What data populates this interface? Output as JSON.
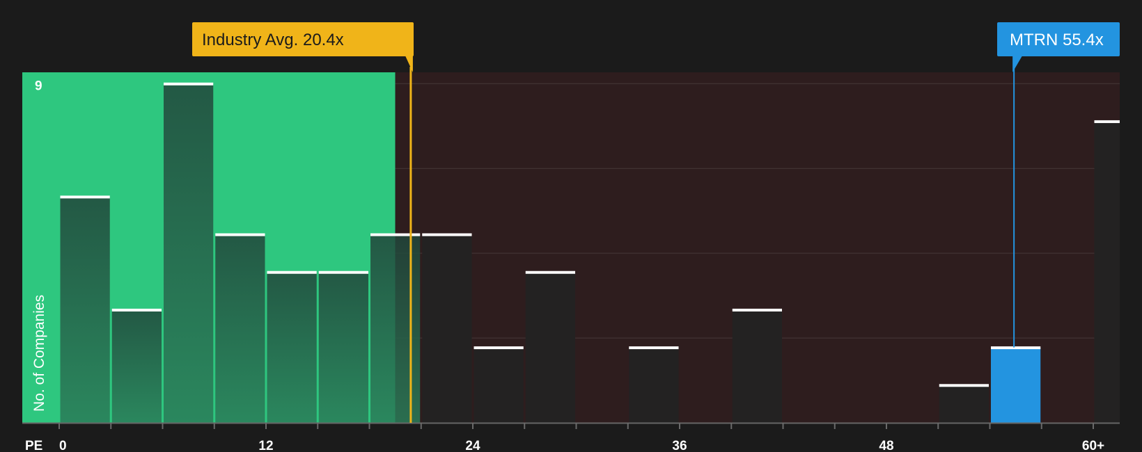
{
  "chart_data": {
    "type": "bar",
    "title": "",
    "xlabel": "PE",
    "ylabel": "No. of Companies",
    "bin_width": 3,
    "x_ticks": [
      {
        "value": 0,
        "label": "0"
      },
      {
        "value": 12,
        "label": "12"
      },
      {
        "value": 24,
        "label": "24"
      },
      {
        "value": 36,
        "label": "36"
      },
      {
        "value": 48,
        "label": "48"
      },
      {
        "value": 60,
        "label": "60+"
      }
    ],
    "xlim": [
      -2.2,
      61.5
    ],
    "ylim": [
      0,
      9.3
    ],
    "y_ticks": [
      {
        "value": 9,
        "label": "9"
      }
    ],
    "gridlines": [
      2.25,
      4.5,
      6.75,
      9
    ],
    "bins": [
      {
        "start": 0,
        "count": 6
      },
      {
        "start": 3,
        "count": 3
      },
      {
        "start": 6,
        "count": 9
      },
      {
        "start": 9,
        "count": 5
      },
      {
        "start": 12,
        "count": 4
      },
      {
        "start": 15,
        "count": 4
      },
      {
        "start": 18,
        "count": 5
      },
      {
        "start": 21,
        "count": 5
      },
      {
        "start": 24,
        "count": 2
      },
      {
        "start": 27,
        "count": 4
      },
      {
        "start": 33,
        "count": 2
      },
      {
        "start": 39,
        "count": 3
      },
      {
        "start": 51,
        "count": 1
      },
      {
        "start": 54,
        "count": 2,
        "highlight": true
      },
      {
        "start": 60,
        "count": 8
      }
    ],
    "fair_zone_max": 19.5,
    "industry_avg": {
      "value": 20.4,
      "label": "Industry Avg. 20.4x"
    },
    "company": {
      "value": 55.4,
      "label": "MTRN 55.4x"
    },
    "colors": {
      "background": "#1b1b1b",
      "fair_zone": "#2ec77f",
      "expensive_zone": "#2e1d1e",
      "bar": "#232222",
      "highlight": "#2394e0",
      "industry_avg": "#f0b419",
      "bar_top": "#ffffff",
      "gridline": "#ffffff"
    }
  }
}
